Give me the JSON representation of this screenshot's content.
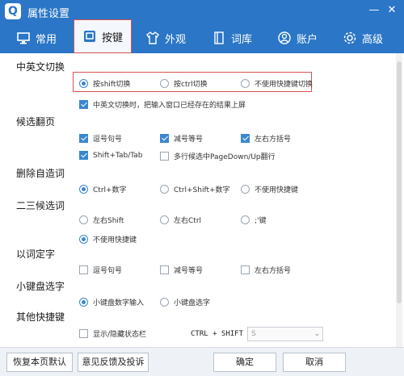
{
  "window": {
    "title": "属性设置",
    "app_icon": "Q"
  },
  "tabs": [
    {
      "label": "常用",
      "icon": "monitor-icon"
    },
    {
      "label": "按键",
      "icon": "keyboard-icon"
    },
    {
      "label": "外观",
      "icon": "shirt-icon"
    },
    {
      "label": "词库",
      "icon": "book-icon"
    },
    {
      "label": "账户",
      "icon": "user-icon"
    },
    {
      "label": "高级",
      "icon": "gear-icon"
    }
  ],
  "sections": {
    "cn_en_switch": {
      "title": "中英文切换",
      "options": [
        "按shift切换",
        "按ctrl切换",
        "不使用快捷键切换"
      ],
      "checkbox": "中英文切换时，把输入窗口已经存在的结果上屏"
    },
    "page_flip": {
      "title": "候选翻页",
      "options": [
        "逗号句号",
        "减号等号",
        "左右方括号",
        "Shift+Tab/Tab",
        "多行候选中PageDown/Up翻行"
      ]
    },
    "delete_word": {
      "title": "删除自造词",
      "options": [
        "Ctrl+数字",
        "Ctrl+Shift+数字",
        "不使用快捷键"
      ]
    },
    "second_third": {
      "title": "二三候选词",
      "options": [
        "左右Shift",
        "左右Ctrl",
        ";'键",
        "不使用快捷键"
      ]
    },
    "word_select": {
      "title": "以词定字",
      "options": [
        "逗号句号",
        "减号等号",
        "左右方括号"
      ]
    },
    "numpad": {
      "title": "小键盘选字",
      "options": [
        "小键盘数字输入",
        "小键盘选字"
      ]
    },
    "other_hotkeys": {
      "title": "其他快捷键",
      "checkbox": "显示/隐藏状态栏",
      "hotkey_label": "CTRL + SHIFT +",
      "hotkey_value": "S"
    }
  },
  "footer": {
    "restore_default": "恢复本页默认",
    "feedback": "意见反馈及投诉",
    "ok": "确定",
    "cancel": "取消"
  }
}
